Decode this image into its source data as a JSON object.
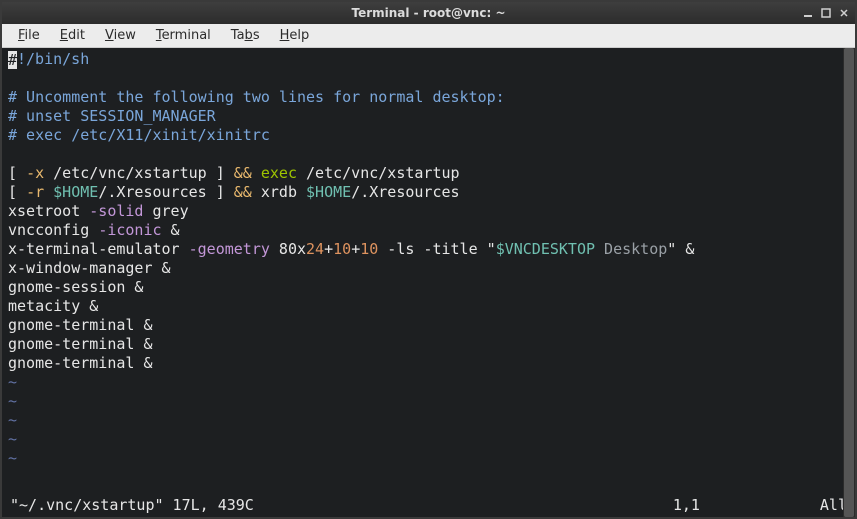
{
  "window": {
    "title": "Terminal - root@vnc: ~"
  },
  "menubar": {
    "items": [
      {
        "ul": "F",
        "rest": "ile"
      },
      {
        "ul": "E",
        "rest": "dit"
      },
      {
        "ul": "V",
        "rest": "iew"
      },
      {
        "ul": "T",
        "rest": "erminal"
      },
      {
        "ul": "",
        "rest": "Ta",
        "ul2": "b",
        "rest2": "s"
      },
      {
        "ul": "H",
        "rest": "elp"
      }
    ]
  },
  "editor": {
    "content": [
      [
        {
          "cursor": true,
          "text": "#"
        },
        {
          "cls": "c-blue",
          "text": "!/bin/sh"
        }
      ],
      [],
      [
        {
          "cls": "c-blue",
          "text": "# Uncomment the following two lines for normal desktop:"
        }
      ],
      [
        {
          "cls": "c-blue",
          "text": "# unset SESSION_MANAGER"
        }
      ],
      [
        {
          "cls": "c-blue",
          "text": "# exec /etc/X11/xinit/xinitrc"
        }
      ],
      [],
      [
        {
          "cls": "c-white",
          "text": "[ "
        },
        {
          "cls": "c-yellow",
          "text": "-x"
        },
        {
          "cls": "c-white",
          "text": " /etc/vnc/xstartup ] "
        },
        {
          "cls": "c-yellow",
          "text": "&&"
        },
        {
          "cls": "c-white",
          "text": " "
        },
        {
          "cls": "c-green",
          "text": "exec"
        },
        {
          "cls": "c-white",
          "text": " /etc/vnc/xstartup"
        }
      ],
      [
        {
          "cls": "c-white",
          "text": "[ "
        },
        {
          "cls": "c-yellow",
          "text": "-r"
        },
        {
          "cls": "c-white",
          "text": " "
        },
        {
          "cls": "c-cyan",
          "text": "$HOME"
        },
        {
          "cls": "c-white",
          "text": "/.Xresources ] "
        },
        {
          "cls": "c-yellow",
          "text": "&&"
        },
        {
          "cls": "c-white",
          "text": " xrdb "
        },
        {
          "cls": "c-cyan",
          "text": "$HOME"
        },
        {
          "cls": "c-white",
          "text": "/.Xresources"
        }
      ],
      [
        {
          "cls": "c-white",
          "text": "xsetroot "
        },
        {
          "cls": "c-pink",
          "text": "-solid"
        },
        {
          "cls": "c-white",
          "text": " grey"
        }
      ],
      [
        {
          "cls": "c-white",
          "text": "vncconfig "
        },
        {
          "cls": "c-pink",
          "text": "-iconic"
        },
        {
          "cls": "c-white",
          "text": " &"
        }
      ],
      [
        {
          "cls": "c-white",
          "text": "x-terminal-emulator "
        },
        {
          "cls": "c-pink",
          "text": "-geometry"
        },
        {
          "cls": "c-white",
          "text": " 80x"
        },
        {
          "cls": "c-orange",
          "text": "24"
        },
        {
          "cls": "c-white",
          "text": "+"
        },
        {
          "cls": "c-orange",
          "text": "10"
        },
        {
          "cls": "c-white",
          "text": "+"
        },
        {
          "cls": "c-orange",
          "text": "10"
        },
        {
          "cls": "c-white",
          "text": " -ls -title "
        },
        {
          "cls": "c-white",
          "text": "\""
        },
        {
          "cls": "c-cyan",
          "text": "$VNCDESKTOP"
        },
        {
          "cls": "c-grey",
          "text": " Desktop"
        },
        {
          "cls": "c-white",
          "text": "\" &"
        }
      ],
      [
        {
          "cls": "c-white",
          "text": "x-window-manager &"
        }
      ],
      [
        {
          "cls": "c-white",
          "text": "gnome-session &"
        }
      ],
      [
        {
          "cls": "c-white",
          "text": "metacity &"
        }
      ],
      [
        {
          "cls": "c-white",
          "text": "gnome-terminal &"
        }
      ],
      [
        {
          "cls": "c-white",
          "text": "gnome-terminal &"
        }
      ],
      [
        {
          "cls": "c-white",
          "text": "gnome-terminal &"
        }
      ]
    ],
    "tilde_rows": 5
  },
  "status": {
    "filename": "\"~/.vnc/xstartup\"",
    "meta": " 17L, 439C",
    "cursor": "1,1",
    "position": "All"
  }
}
